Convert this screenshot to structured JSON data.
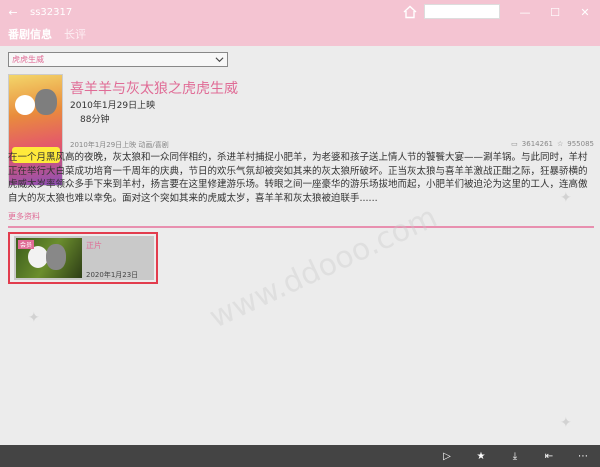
{
  "window": {
    "title": "ss32317",
    "back_icon": "back-arrow-icon",
    "home_icon": "home-icon",
    "search_placeholder": "",
    "minimize": "—",
    "maximize": "☐",
    "close": "✕"
  },
  "nav": {
    "tabs": [
      {
        "label": "番剧信息",
        "active": true
      },
      {
        "label": "长评",
        "active": false
      }
    ]
  },
  "season_select": {
    "selected": "虎虎生威"
  },
  "show": {
    "title": "喜羊羊与灰太狼之虎虎生威",
    "release": "2010年1月29日上映",
    "duration": "88分钟",
    "meta": "2010年1月29日上映 动画/喜剧",
    "views": "3614261",
    "favorites": "955085",
    "description": "在一个月黑风高的夜晚，灰太狼和一众同伴相约，杀进羊村捕捉小肥羊，为老婆和孩子送上情人节的饕餮大宴——涮羊锅。与此同时，羊村正在举行大白菜成功培育一千周年的庆典，节日的欢乐气氛却被突如其来的灰太狼所破坏。正当灰太狼与喜羊羊激战正酣之际，狂暴骄横的虎威太岁率领众多手下来到羊村，扬言要在这里修建游乐场。转眼之间一座豪华的游乐场拔地而起，小肥羊们被迫沦为这里的工人，连高傲自大的灰太狼也难以幸免。面对这个突如其来的虎威太岁，喜羊羊和灰太狼被迫联手......",
    "more_label": "更多资料"
  },
  "episodes": [
    {
      "badge": "会员",
      "name": "正片",
      "date": "2020年1月23日"
    }
  ],
  "watermark": "www.ddooo.com",
  "commandbar": {
    "icons": [
      "play-icon",
      "star-icon",
      "download-icon",
      "pin-icon",
      "more-icon"
    ],
    "glyphs": [
      "▷",
      "★",
      "⤓",
      "⇤",
      "⋯"
    ]
  }
}
